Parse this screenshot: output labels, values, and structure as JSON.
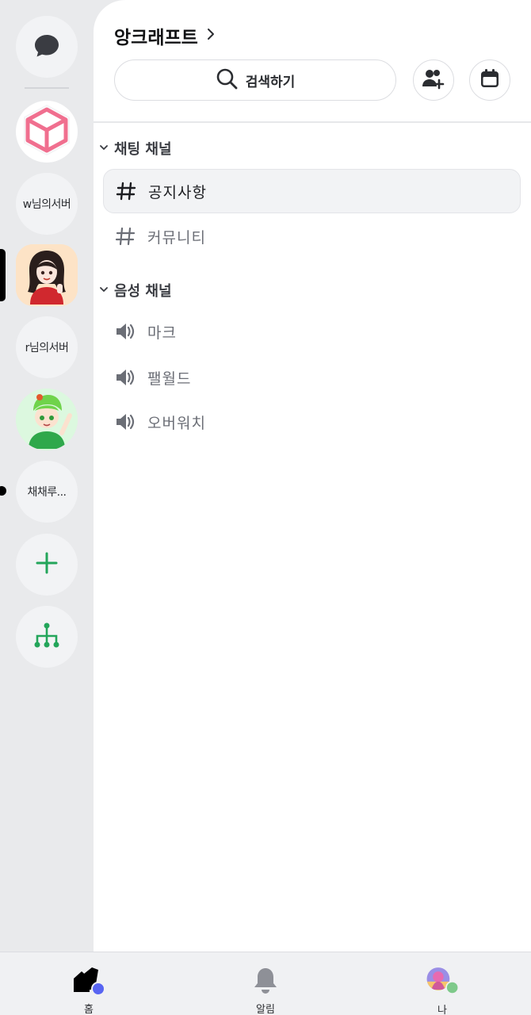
{
  "rail": {
    "dm_icon": "chat-bubble-icon",
    "servers": [
      {
        "type": "icon",
        "icon": "cube-icon"
      },
      {
        "type": "text",
        "label": "w님의서버"
      },
      {
        "type": "avatar",
        "icon": "girl-avatar-icon"
      },
      {
        "type": "text",
        "label": "r님의서버"
      },
      {
        "type": "avatar",
        "icon": "green-character-avatar-icon"
      },
      {
        "type": "text",
        "label": "채채루..."
      }
    ],
    "add_icon": "plus-icon",
    "explore_icon": "hierarchy-icon"
  },
  "server": {
    "title": "앙크래프트",
    "title_icon": "chevron-right-icon"
  },
  "search": {
    "label": "검색하기",
    "icon": "search-icon"
  },
  "actions": {
    "invite_icon": "add-user-icon",
    "events_icon": "calendar-icon"
  },
  "categories": [
    {
      "label": "채팅 채널",
      "channels": [
        {
          "label": "공지사항",
          "icon": "hash-icon",
          "active": true
        },
        {
          "label": "커뮤니티",
          "icon": "hash-icon",
          "active": false
        }
      ]
    },
    {
      "label": "음성 채널",
      "channels": [
        {
          "label": "마크",
          "icon": "speaker-icon"
        },
        {
          "label": "팰월드",
          "icon": "speaker-icon"
        },
        {
          "label": "오버워치",
          "icon": "speaker-icon"
        }
      ]
    }
  ],
  "nav": {
    "home": "홈",
    "notifications": "알림",
    "me": "나"
  },
  "colors": {
    "accent_green": "#23a55a",
    "blurple": "#5865f2",
    "pink_cube": "#f06f8f"
  }
}
